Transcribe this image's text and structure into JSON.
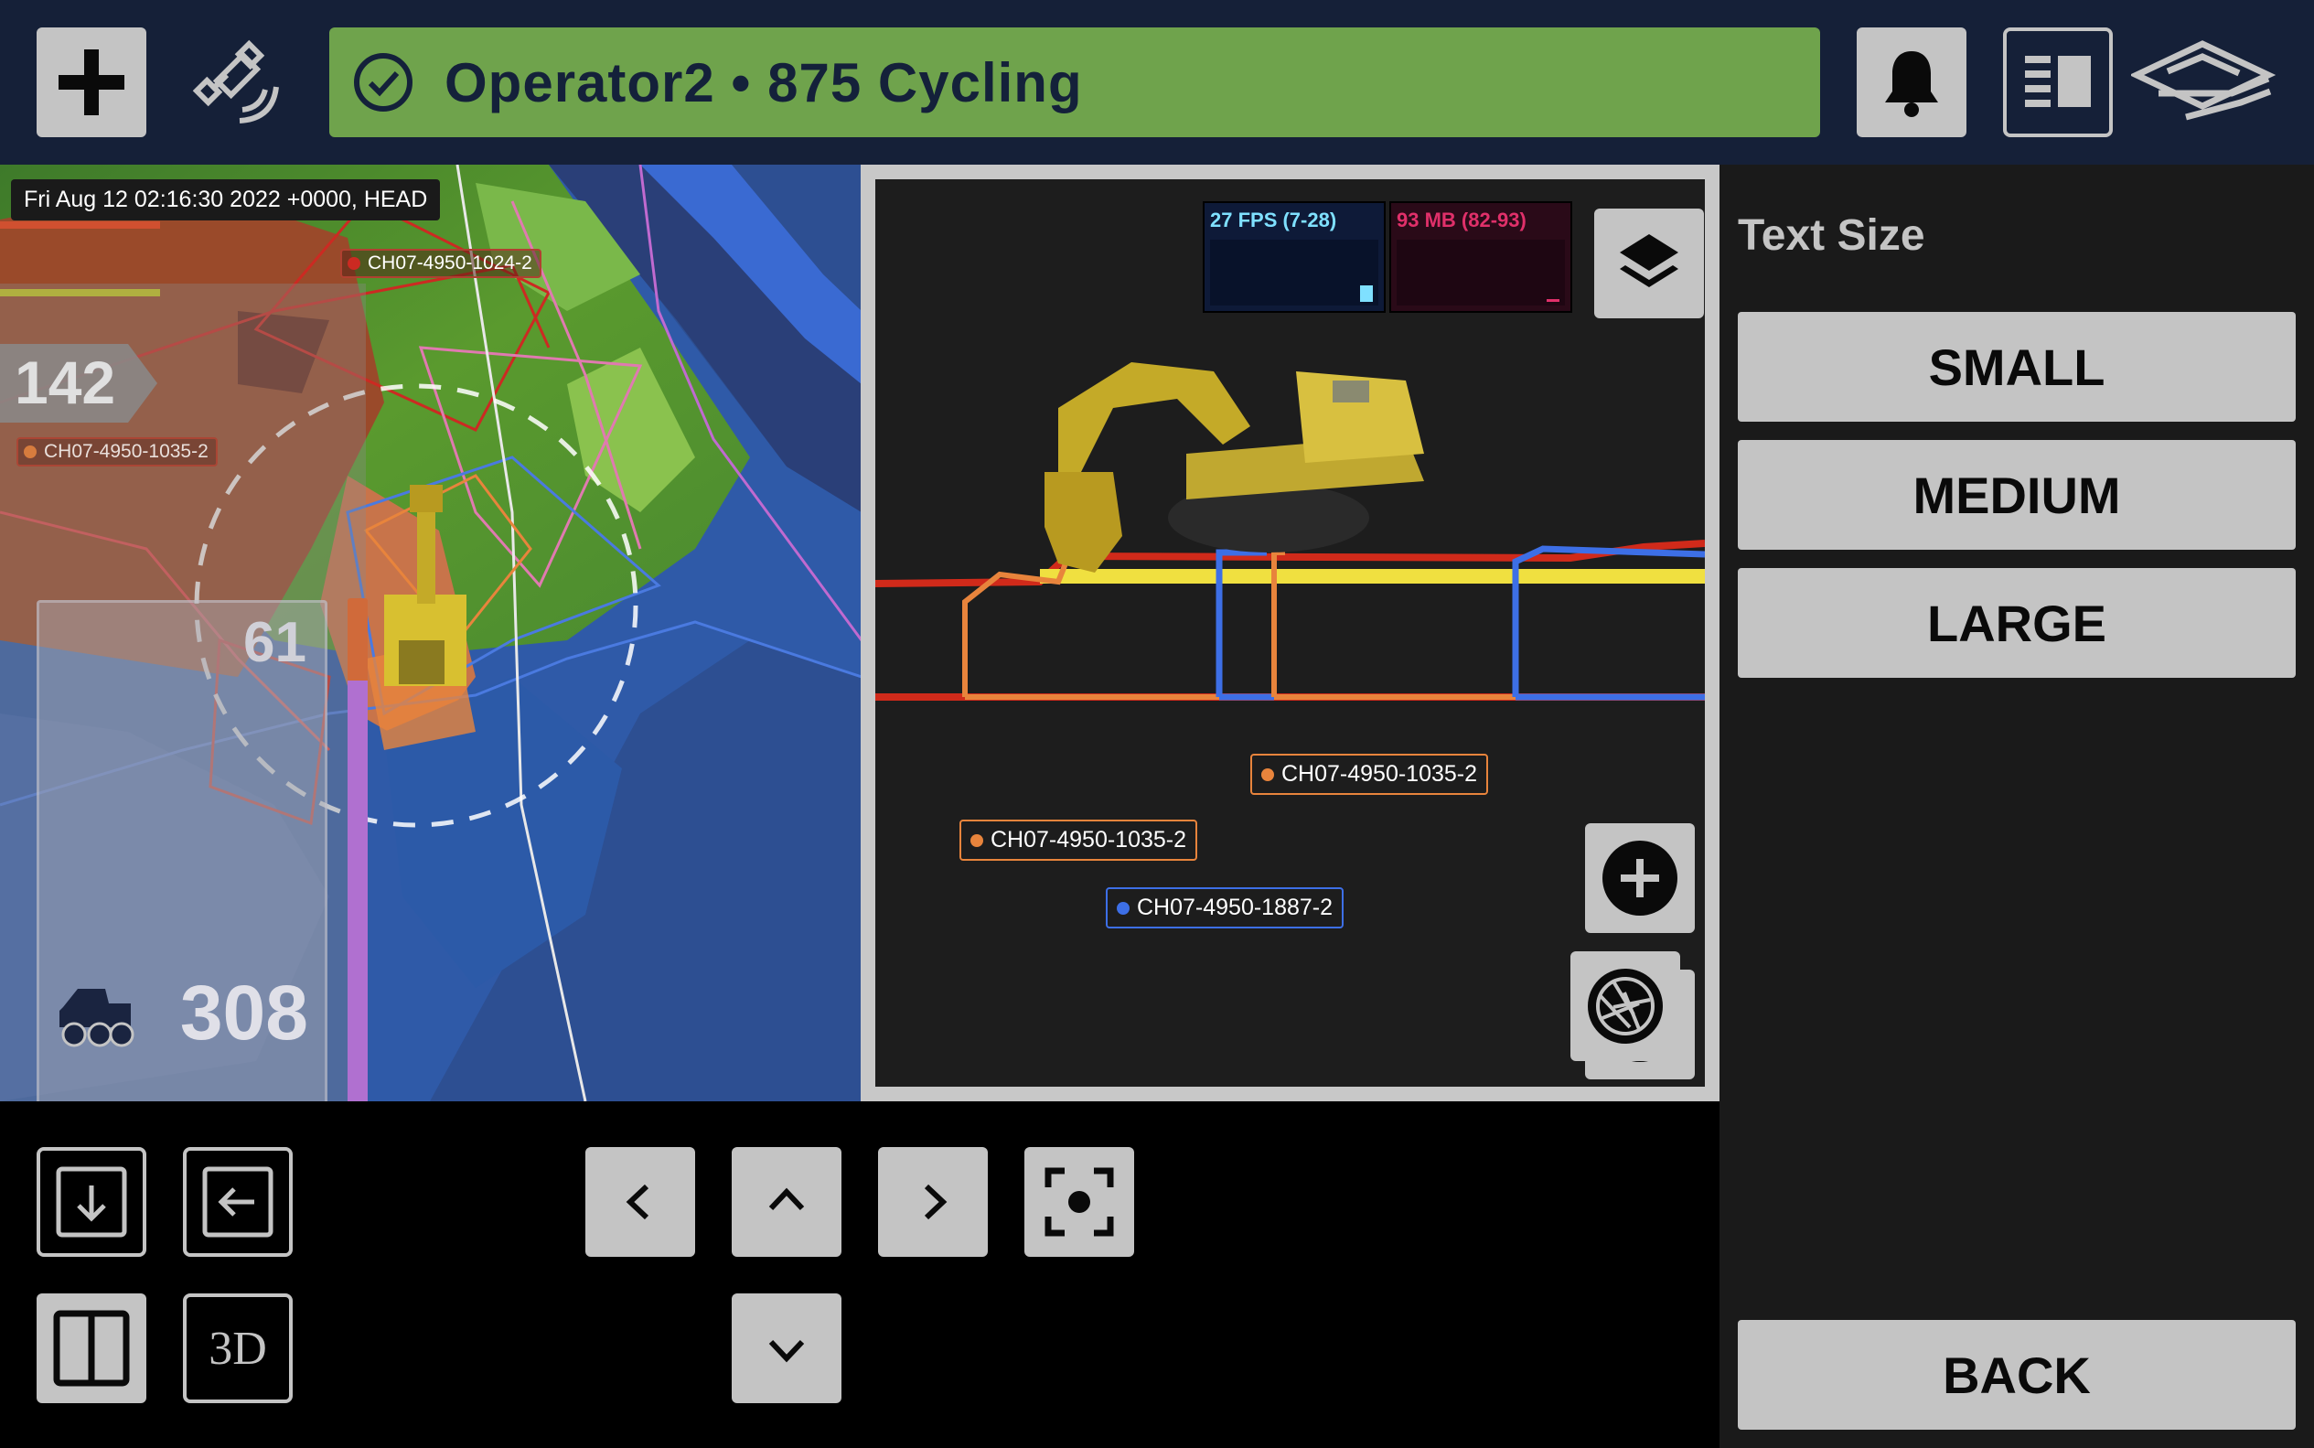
{
  "topbar": {
    "status_text": "Operator2 • 875 Cycling",
    "colors": {
      "bar": "#152038",
      "status": "#6fa34c",
      "button": "#c4c4c4"
    },
    "icons": [
      "plus-icon",
      "satellite-icon",
      "check-circle-icon",
      "bell-icon",
      "panel-layout-icon",
      "logo-icon"
    ]
  },
  "map": {
    "timestamp": "Fri Aug 12 02:16:30 2022 +0000, HEAD",
    "labels": [
      "CH07-4950-1024-2",
      "CH07-4950-1035-2"
    ],
    "counter_top": "142",
    "counter_mid": "61",
    "counter_bottom": "308"
  },
  "profile": {
    "fps": "27 FPS (7-28)",
    "mem": "93 MB (82-93)",
    "holes": [
      {
        "label": "CH07-4950-1035-2",
        "color": "#e8843c"
      },
      {
        "label": "CH07-4950-1035-2",
        "color": "#e8843c"
      },
      {
        "label": "CH07-4950-1887-2",
        "color": "#3d6fe6"
      }
    ]
  },
  "text_size": {
    "title": "Text Size",
    "small": "SMALL",
    "medium": "MEDIUM",
    "large": "LARGE",
    "back": "BACK"
  },
  "bottom_controls": {
    "view_3d_label": "3D"
  }
}
